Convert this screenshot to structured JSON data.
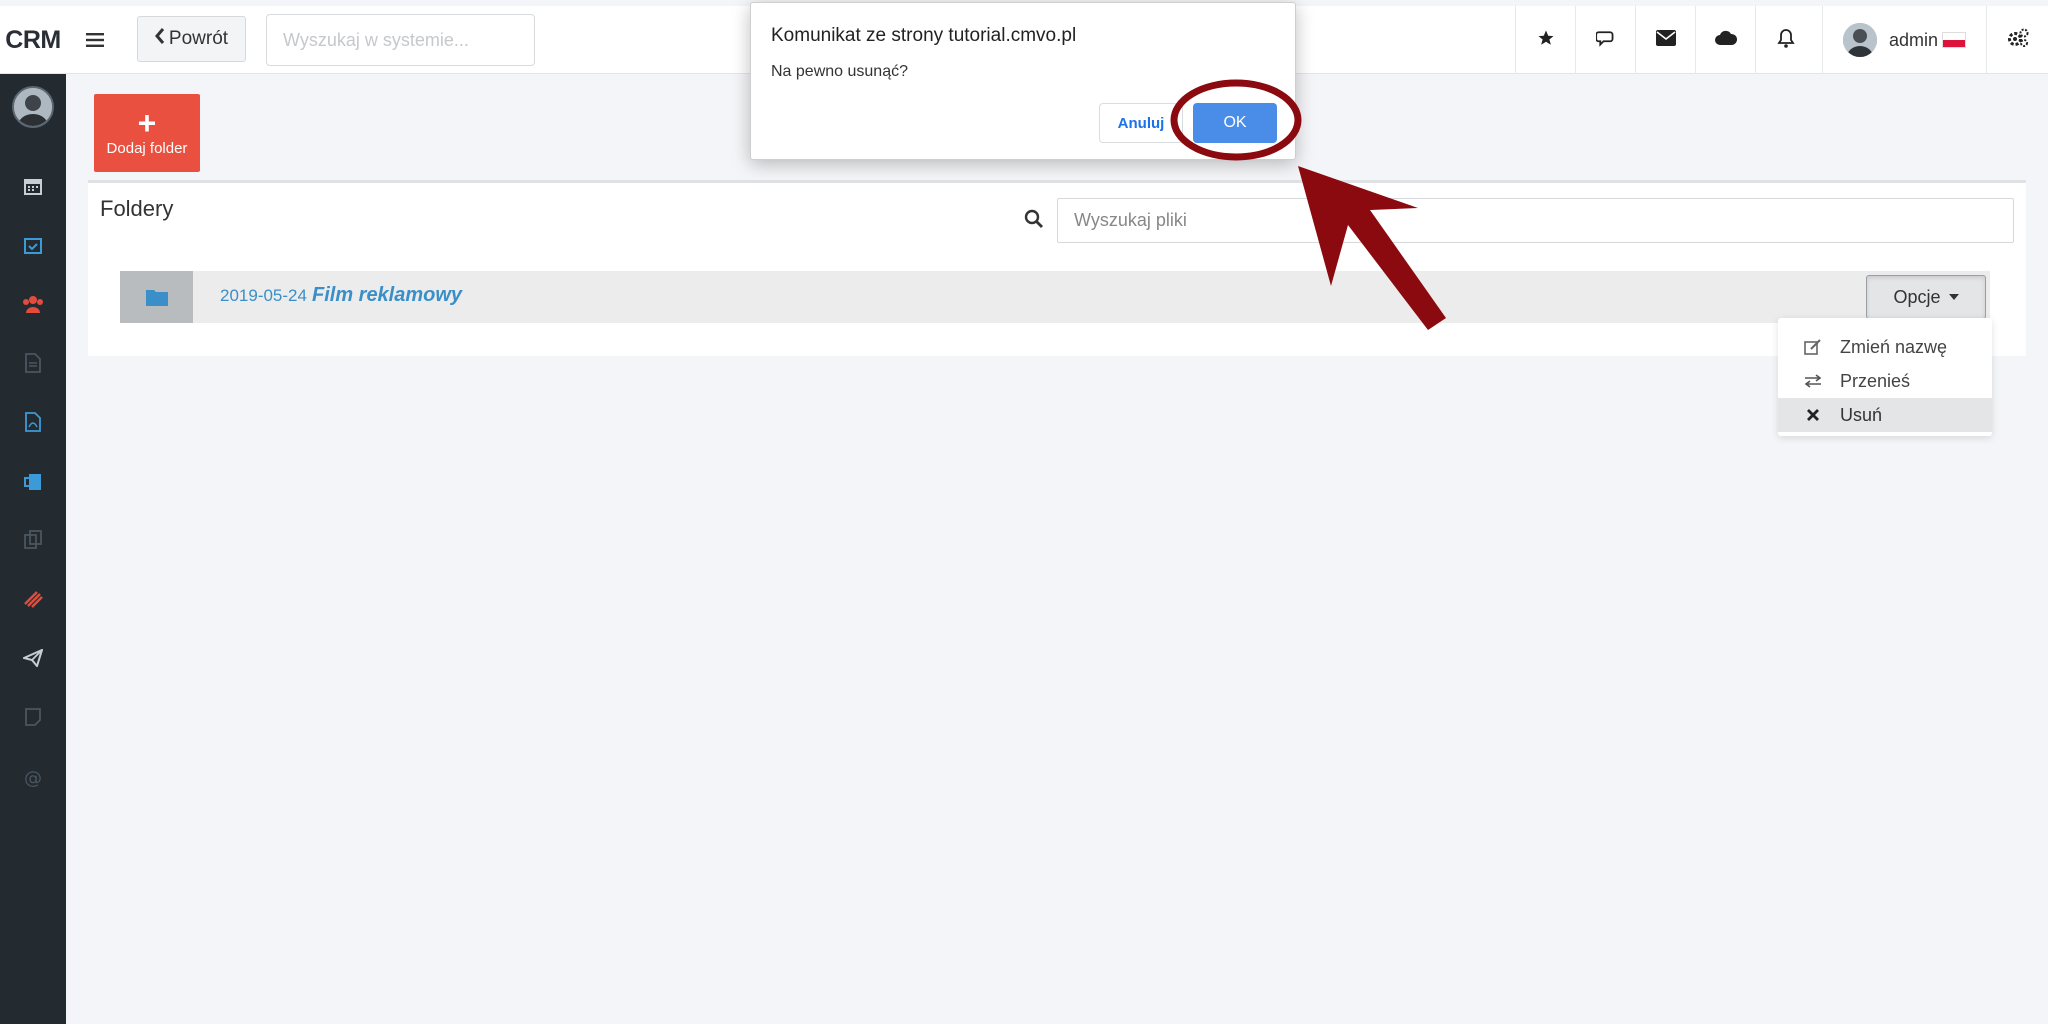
{
  "topbar": {
    "brand": "CRM",
    "back_label": "Powrót",
    "search_placeholder": "Wyszukaj w systemie...",
    "user_name": "admin",
    "icons": [
      "star-icon",
      "chat-icon",
      "envelope-icon",
      "cloud-icon",
      "bell-icon",
      "settings-icon"
    ]
  },
  "sidebar": {
    "items": [
      "calendar-icon",
      "calendar-check-icon",
      "users-icon",
      "document-icon",
      "pdf-icon",
      "clipboard-icon",
      "copy-icon",
      "attachment-icon",
      "paper-plane-icon",
      "note-icon",
      "at-sign-icon"
    ]
  },
  "main": {
    "add_folder_label": "Dodaj folder",
    "panel_title": "Foldery",
    "file_search_placeholder": "Wyszukaj pliki",
    "folder": {
      "date": "2019-05-24",
      "name": "Film reklamowy",
      "options_label": "Opcje"
    },
    "dropdown": [
      {
        "label": "Zmień nazwę",
        "icon": "edit-icon"
      },
      {
        "label": "Przenieś",
        "icon": "transfer-icon"
      },
      {
        "label": "Usuń",
        "icon": "times-icon"
      }
    ]
  },
  "dialog": {
    "title": "Komunikat ze strony tutorial.cmvo.pl",
    "message": "Na pewno usunąć?",
    "cancel_label": "Anuluj",
    "ok_label": "OK"
  },
  "colors": {
    "sidebar_bg": "#232b31",
    "add_folder_bg": "#e9503f",
    "link_blue": "#3a8fc8",
    "dialog_ok_bg": "#4a8de8",
    "annotation_red": "#8b0a10"
  }
}
